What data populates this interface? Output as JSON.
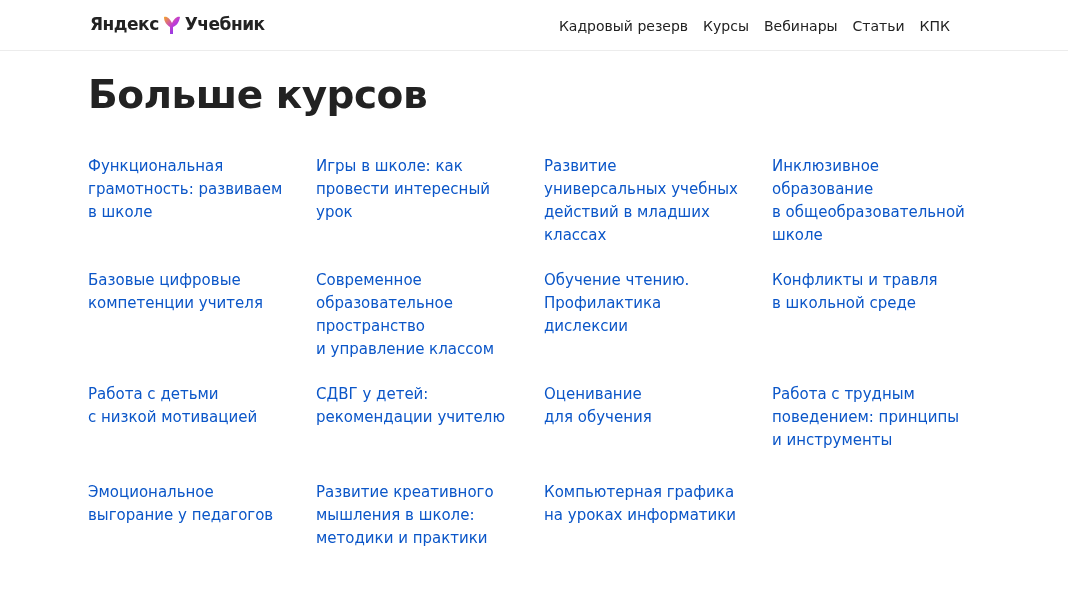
{
  "header": {
    "logo": {
      "brand": "Яндекс",
      "product": "Учебник"
    },
    "nav": [
      "Кадровый резерв",
      "Курсы",
      "Вебинары",
      "Статьи",
      "КПК"
    ]
  },
  "title": "Больше курсов",
  "courses": [
    "Функциональная\nграмотность: развиваем\nв школе",
    "Игры в школе: как\nпровести интересный\nурок",
    "Развитие\nуниверсальных учебных\nдействий в младших\nклассах",
    "Инклюзивное\nобразование\nв общеобразовательной\nшколе",
    "Базовые цифровые\nкомпетенции учителя",
    "Современное\nобразовательное\nпространство\nи управление классом",
    "Обучение чтению.\nПрофилактика\nдислексии",
    "Конфликты и травля\nв школьной среде",
    "Работа с детьми\nс низкой мотивацией",
    "СДВГ у детей:\nрекомендации учителю",
    "Оценивание\nдля обучения",
    "Работа с трудным\nповедением: принципы\nи инструменты",
    "Эмоциональное\nвыгорание у педагогов",
    "Развитие креативного\nмышления в школе:\nметодики и практики",
    "Компьютерная графика\nна уроках информатики"
  ]
}
